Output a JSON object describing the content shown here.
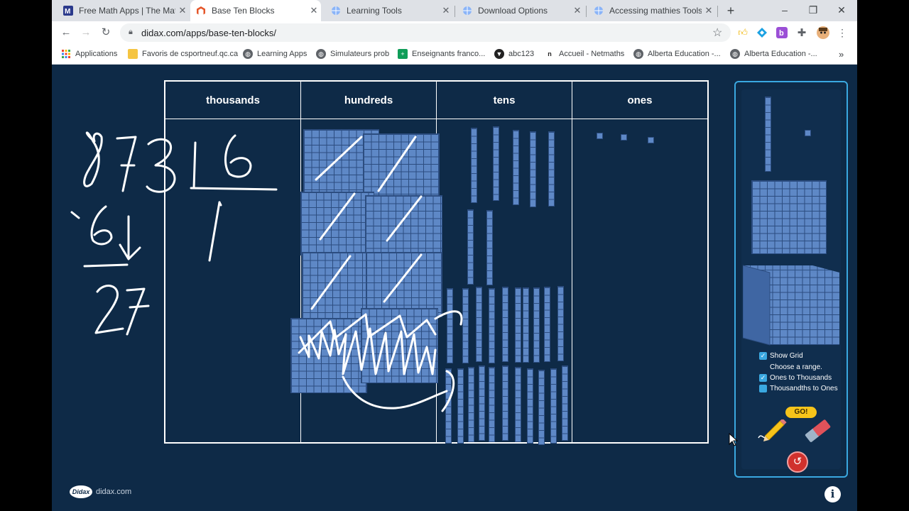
{
  "tabs": [
    {
      "title": "Free Math Apps | The Math",
      "active": false
    },
    {
      "title": "Base Ten Blocks",
      "active": true
    },
    {
      "title": "Learning Tools",
      "active": false
    },
    {
      "title": "Download Options",
      "active": false
    },
    {
      "title": "Accessing mathies Tools",
      "active": false
    }
  ],
  "window_controls": {
    "minimize": "–",
    "restore": "❐",
    "close": "✕"
  },
  "address_bar": {
    "url": "didax.com/apps/base-ten-blocks/"
  },
  "bookmarks": [
    {
      "label": "Applications"
    },
    {
      "label": "Favoris de csportneuf.qc.ca"
    },
    {
      "label": "Learning Apps"
    },
    {
      "label": "Simulateurs prob"
    },
    {
      "label": "Enseignants franco..."
    },
    {
      "label": "abc123"
    },
    {
      "label": "Accueil - Netmaths"
    },
    {
      "label": "Alberta Education -..."
    },
    {
      "label": "Alberta Education -..."
    }
  ],
  "bookmarks_overflow": "»",
  "columns": [
    "thousands",
    "hundreds",
    "tens",
    "ones"
  ],
  "block_counts": {
    "hundreds_flats": 8,
    "tens_rods": 31,
    "ones_units": 3
  },
  "panel": {
    "show_grid_label": "Show Grid",
    "show_grid_checked": true,
    "choose_range_label": "Choose a range.",
    "range_options": [
      {
        "label": "Ones to Thousands",
        "checked": true
      },
      {
        "label": "Thousandths to Ones",
        "checked": false
      }
    ],
    "go_label": "GO!"
  },
  "handwriting": {
    "dividend": "873",
    "divisor": "6",
    "quotient_digit": "1",
    "subtrahend": "6",
    "difference": "27"
  },
  "footer": {
    "logo": "Didax",
    "site": "didax.com"
  },
  "colors": {
    "app_background": "#0e2a47",
    "block_blue": "#5e88c6",
    "panel_border": "#3aa8e0",
    "go_yellow": "#f7c41a",
    "undo_red": "#d0312d"
  }
}
